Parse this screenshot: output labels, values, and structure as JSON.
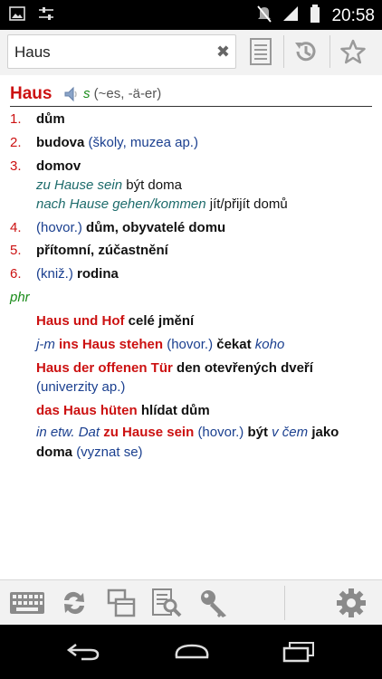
{
  "status_bar": {
    "time": "20:58"
  },
  "search": {
    "value": "Haus"
  },
  "entry": {
    "headword": "Haus",
    "gender": "s",
    "forms": "(~es, -ä-er)",
    "senses": [
      {
        "num": "1.",
        "text": "dům"
      },
      {
        "num": "2.",
        "text": "budova",
        "note": "(školy, muzea ap.)"
      },
      {
        "num": "3.",
        "text": "domov",
        "examples": [
          {
            "phrase": "zu Hause sein",
            "translation": "být doma"
          },
          {
            "phrase": "nach Hause gehen/kommen",
            "translation": "jít/přijít domů"
          }
        ]
      },
      {
        "num": "4.",
        "label": "(hovor.)",
        "text": "dům, obyvatelé domu"
      },
      {
        "num": "5.",
        "text": "přítomní, zúčastnění"
      },
      {
        "num": "6.",
        "label": "(kniž.)",
        "text": "rodina"
      }
    ],
    "phr_label": "phr",
    "phrases": [
      {
        "de": "Haus und Hof",
        "cz": "celé jmění"
      },
      {
        "pre": "j-m",
        "de": "ins Haus stehen",
        "label": "(hovor.)",
        "cz": "čekat",
        "post": "koho"
      },
      {
        "de": "Haus der offenen Tür",
        "cz": "den otevřených dveří",
        "note": "(univerzity ap.)"
      },
      {
        "de": "das Haus hüten",
        "cz": "hlídat dům"
      },
      {
        "pre": "in etw.",
        "pre2": "Dat",
        "de": "zu Hause sein",
        "label": "(hovor.)",
        "cz": "být",
        "mid": "v čem",
        "cz2": "jako",
        "cz3": "doma",
        "note": "(vyznat se)"
      }
    ]
  }
}
